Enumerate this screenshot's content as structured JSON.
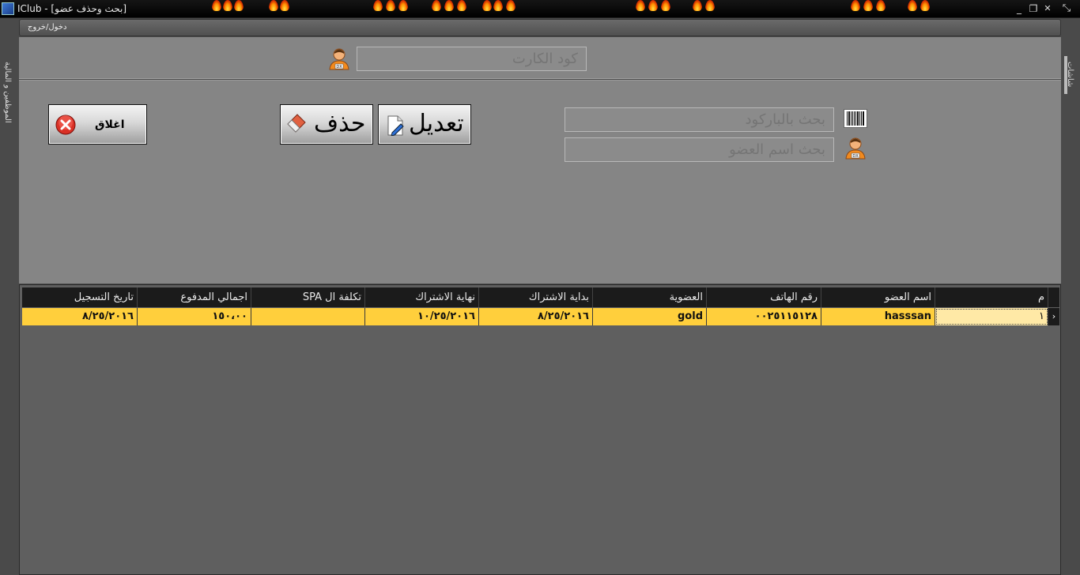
{
  "window": {
    "title": "IClub - [بحث وحذف عضو]",
    "buttons": {
      "minimize": "_",
      "restore": "❐",
      "close": "✕"
    }
  },
  "side": {
    "left_label": "الموظفين و المالية",
    "right_label": "شاشات"
  },
  "menubar": {
    "item": "دخول/خروج"
  },
  "card_code": {
    "placeholder": "كود الكارت"
  },
  "search": {
    "barcode_placeholder": "بحث بالباركود",
    "name_placeholder": "بحث اسم العضو"
  },
  "buttons": {
    "edit": "تعديل",
    "delete": "حذف",
    "close": "اغلاق"
  },
  "grid": {
    "columns": [
      "م",
      "اسم العضو",
      "رقم الهاتف",
      "العضوية",
      "بداية الاشتراك",
      "نهاية الاشتراك",
      "تكلفة ال SPA",
      "اجمالي المدفوع",
      "تاريخ التسجيل"
    ],
    "rows": [
      {
        "index": "١",
        "name": "hasssan",
        "phone": "٠٠٢٥١١٥١٢٨",
        "membership": "gold",
        "start": "٨/٢٥/٢٠١٦",
        "end": "١٠/٢٥/٢٠١٦",
        "spa_cost": "",
        "total_paid": "١٥٠،٠٠",
        "registered": "٨/٢٥/٢٠١٦"
      }
    ]
  },
  "colors": {
    "panel": "#858585",
    "grid_bg": "#5f5f5f",
    "header_bg": "#1b1b1b",
    "selected_row": "#ffcf3c"
  }
}
